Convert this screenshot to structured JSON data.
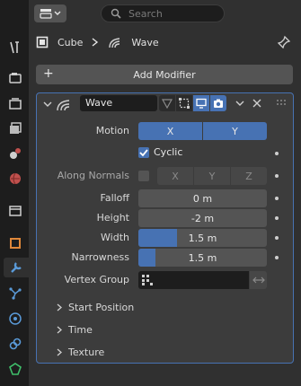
{
  "header": {
    "search_placeholder": "Search"
  },
  "breadcrumb": {
    "object": "Cube",
    "modifier": "Wave"
  },
  "add_modifier_label": "Add Modifier",
  "modifier": {
    "name": "Wave",
    "motion": {
      "label": "Motion",
      "x": "X",
      "y": "Y"
    },
    "cyclic": {
      "label": "Cyclic",
      "checked": true
    },
    "along_normals": {
      "label": "Along Normals",
      "x": "X",
      "y": "Y",
      "z": "Z",
      "checked": false
    },
    "falloff": {
      "label": "Falloff",
      "value": "0 m"
    },
    "height": {
      "label": "Height",
      "value": "-2 m"
    },
    "width": {
      "label": "Width",
      "value": "1.5 m",
      "fill": 0.3
    },
    "narrowness": {
      "label": "Narrowness",
      "value": "1.5 m",
      "fill": 0.13
    },
    "vertex_group": {
      "label": "Vertex Group",
      "value": ""
    },
    "subpanels": [
      "Start Position",
      "Time",
      "Texture"
    ]
  },
  "colors": {
    "accent": "#4772b3",
    "panel": "#3c3c3c",
    "field": "#545454"
  },
  "tabs": [
    "tool-icon",
    "render-icon",
    "output-icon",
    "view-layer-icon",
    "scene-icon",
    "world-icon",
    "collection-icon",
    "object-icon",
    "modifier-icon",
    "particles-icon",
    "physics-icon",
    "constraints-icon",
    "data-icon"
  ]
}
